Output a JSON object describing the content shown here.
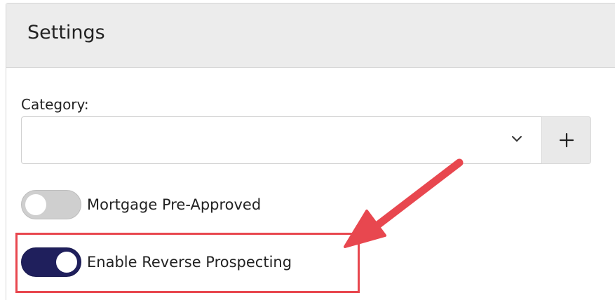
{
  "card": {
    "title": "Settings"
  },
  "category": {
    "label": "Category:",
    "value": "",
    "add_button_symbol": "+"
  },
  "toggles": [
    {
      "label": "Mortgage Pre-Approved",
      "state": "off"
    },
    {
      "label": "Enable Reverse Prospecting",
      "state": "on"
    }
  ],
  "icons": {
    "dropdown": "chevron-down-icon",
    "add": "plus-icon",
    "annotation": "red-arrow-icon"
  },
  "colors": {
    "header_bg": "#ececec",
    "toggle_on": "#1f1f5c",
    "toggle_off": "#cfcfcf",
    "annotation": "#e8474f"
  }
}
